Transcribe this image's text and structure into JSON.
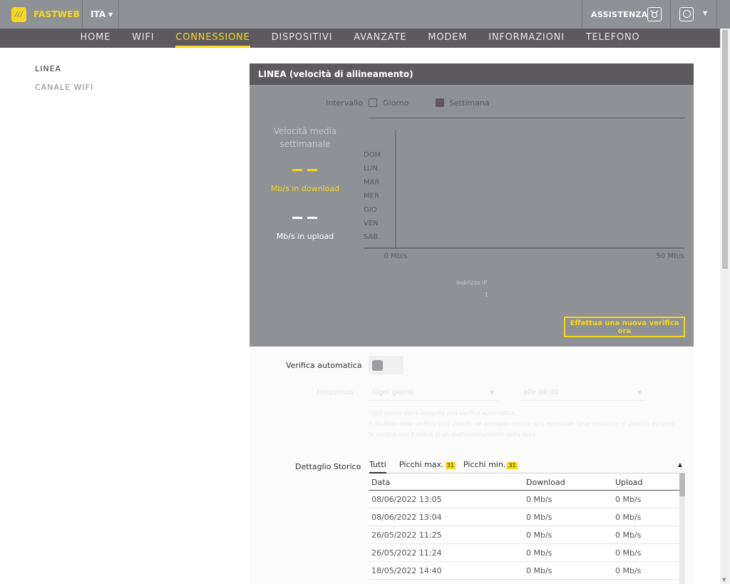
{
  "brand": {
    "name": "FASTWEB",
    "logo_glyph": "///"
  },
  "language": {
    "label": "ITA"
  },
  "assistance": {
    "label": "ASSISTENZA",
    "icon": "assistance-icon"
  },
  "user": {
    "icon": "user-icon"
  },
  "nav": {
    "tabs": [
      {
        "label": "HOME"
      },
      {
        "label": "WIFI"
      },
      {
        "label": "CONNESSIONE",
        "active": true
      },
      {
        "label": "DISPOSITIVI"
      },
      {
        "label": "AVANZATE"
      },
      {
        "label": "MODEM"
      },
      {
        "label": "INFORMAZIONI"
      },
      {
        "label": "TELEFONO"
      }
    ]
  },
  "sidebar": {
    "items": [
      {
        "label": "LINEA",
        "selected": true
      },
      {
        "label": "CANALE WIFI"
      }
    ]
  },
  "panel": {
    "title": "LINEA (velocità di allineamento)",
    "interval_label": "Intervallo",
    "options": [
      {
        "label": "Giorno",
        "checked": false
      },
      {
        "label": "Settimana",
        "checked": true
      }
    ],
    "avg_title": "Velocità media settimanale",
    "download_value": "– –",
    "download_unit": "Mb/s in download",
    "upload_value": "– –",
    "upload_unit": "Mb/s in upload",
    "ip_label": "Indirizzo IP",
    "ip_value": "1",
    "verify_button": "Effettua una nuova verifica ora"
  },
  "chart_data": {
    "type": "bar",
    "orientation": "horizontal",
    "categories": [
      "DOM",
      "LUN",
      "MAR",
      "MER",
      "GIO",
      "VEN",
      "SAB"
    ],
    "series": [],
    "xlim": [
      0,
      50
    ],
    "x_tick_labels": [
      "0 Mb/s",
      "50 Mb/s"
    ],
    "grid": false
  },
  "auto_check": {
    "label": "Verifica automatica",
    "enabled": false,
    "frequency_label": "Frequenza",
    "frequency_value": "Ogni giorno",
    "time_value": "alle 04:00",
    "notes": [
      "Ogni giorno verrà eseguita una verifica automatica.",
      "Il risultato della verifica sarà visibile nel dettaglio storico; una eventuale lieve riduzione di velocità durante",
      "la verifica non è indice di un malfunzionamento della linea."
    ]
  },
  "history": {
    "label": "Dettaglio Storico",
    "tabs": [
      {
        "label": "Tutti",
        "active": true
      },
      {
        "label": "Picchi max.",
        "badge": "31"
      },
      {
        "label": "Picchi min.",
        "badge": "31"
      }
    ],
    "collapse_glyph": "▲",
    "columns": [
      "Data",
      "Download",
      "Upload"
    ],
    "rows": [
      [
        "08/06/2022 13:05",
        "0 Mb/s",
        "0 Mb/s"
      ],
      [
        "08/06/2022 13:04",
        "0 Mb/s",
        "0 Mb/s"
      ],
      [
        "26/05/2022 11:25",
        "0 Mb/s",
        "0 Mb/s"
      ],
      [
        "26/05/2022 11:24",
        "0 Mb/s",
        "0 Mb/s"
      ],
      [
        "18/05/2022 14:40",
        "0 Mb/s",
        "0 Mb/s"
      ]
    ]
  },
  "colors": {
    "accent": "#f8d81c",
    "topbar": "#8e9196",
    "navbar": "#5d5a5f",
    "panel": "#8e9196"
  }
}
